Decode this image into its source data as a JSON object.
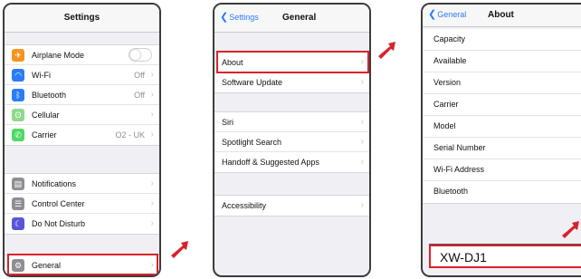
{
  "panel1": {
    "title": "Settings",
    "group1": [
      {
        "label": "Airplane Mode",
        "icon": "airplane-icon",
        "color": "#f7931e",
        "toggle": true
      },
      {
        "label": "Wi-Fi",
        "icon": "wifi-icon",
        "color": "#2b7cf6",
        "value": "Off"
      },
      {
        "label": "Bluetooth",
        "icon": "bluetooth-icon",
        "color": "#2b7cf6",
        "value": "Off"
      },
      {
        "label": "Cellular",
        "icon": "cellular-icon",
        "color": "#5ac35a"
      },
      {
        "label": "Carrier",
        "icon": "phone-icon",
        "color": "#4cd964",
        "value": "O2 - UK"
      }
    ],
    "group2": [
      {
        "label": "Notifications",
        "icon": "notifications-icon",
        "color": "#8e8e93"
      },
      {
        "label": "Control Center",
        "icon": "control-center-icon",
        "color": "#8e8e93"
      },
      {
        "label": "Do Not Disturb",
        "icon": "moon-icon",
        "color": "#5856d6"
      }
    ],
    "group3": [
      {
        "label": "General",
        "icon": "gear-icon",
        "color": "#8e8e93"
      }
    ]
  },
  "panel2": {
    "back": "Settings",
    "title": "General",
    "group1": [
      "About",
      "Software Update"
    ],
    "group2": [
      "Siri",
      "Spotlight Search",
      "Handoff & Suggested Apps"
    ],
    "group3": [
      "Accessibility"
    ]
  },
  "panel3": {
    "back": "General",
    "title": "About",
    "rows": [
      "Capacity",
      "Available",
      "Version",
      "Carrier",
      "Model",
      "Serial Number",
      "Wi-Fi Address",
      "Bluetooth"
    ],
    "device_name": "XW-DJ1"
  },
  "colors": {
    "highlight": "#d8232a",
    "ios_blue": "#2b7cf6"
  }
}
